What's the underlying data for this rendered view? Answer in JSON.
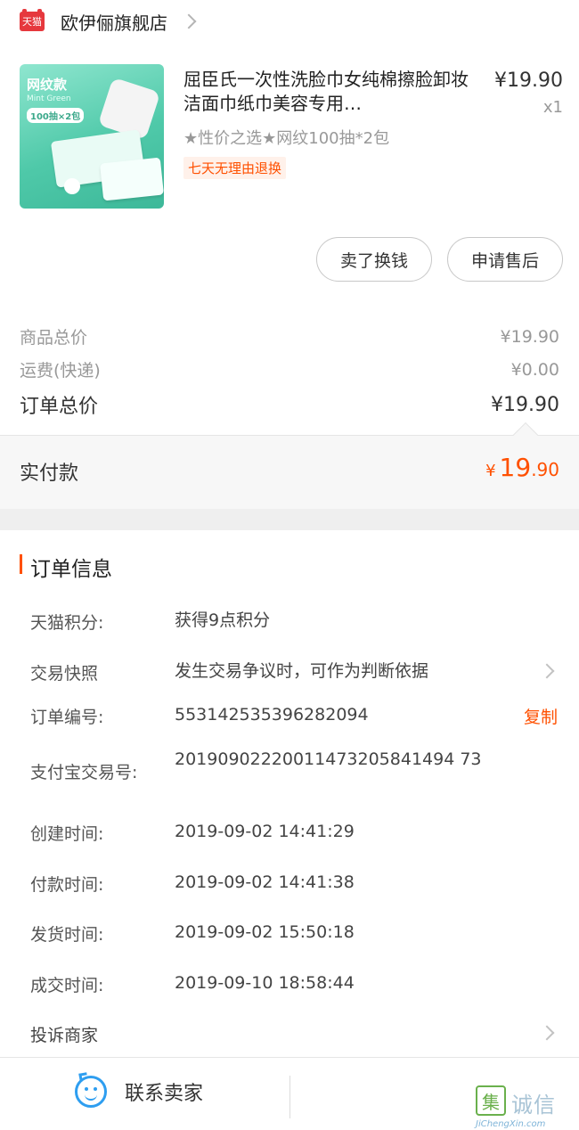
{
  "shop": {
    "badge": "天猫",
    "name": "欧伊俪旗舰店"
  },
  "product": {
    "thumb_tag": "网纹款",
    "thumb_sub": "Mint Green",
    "thumb_count": "100抽×2包",
    "title": "屈臣氏一次性洗脸巾女纯棉擦脸卸妆洁面巾纸巾美容专用…",
    "sku": "★性价之选★网纹100抽*2包",
    "return_badge": "七天无理由退换",
    "price": "¥19.90",
    "quantity": "x1"
  },
  "actions": {
    "sell": "卖了换钱",
    "aftersale": "申请售后"
  },
  "summary": {
    "goods_label": "商品总价",
    "goods_value": "¥19.90",
    "shipping_label": "运费(快递)",
    "shipping_value": "¥0.00",
    "total_label": "订单总价",
    "total_value": "¥19.90",
    "paid_label": "实付款",
    "paid_currency": "¥",
    "paid_int": "19",
    "paid_dec": ".90"
  },
  "order_info": {
    "title": "订单信息",
    "points_label": "天猫积分:",
    "points_value": "获得9点积分",
    "snapshot_label": "交易快照",
    "snapshot_value": "发生交易争议时，可作为判断依据",
    "order_no_label": "订单编号:",
    "order_no_value": "553142535396282094",
    "copy_label": "复制",
    "alipay_label": "支付宝交易号:",
    "alipay_value": "20190902220011473205841494 73",
    "created_label": "创建时间:",
    "created_value": "2019-09-02 14:41:29",
    "paid_label": "付款时间:",
    "paid_value": "2019-09-02 14:41:38",
    "shipped_label": "发货时间:",
    "shipped_value": "2019-09-02 15:50:18",
    "done_label": "成交时间:",
    "done_value": "2019-09-10 18:58:44",
    "complain_label": "投诉商家"
  },
  "bottom": {
    "contact_label": "联系卖家"
  },
  "watermark": {
    "mark": "集",
    "text": "诚信",
    "url": "JiChengXin.com"
  },
  "colors": {
    "accent": "#ff5000",
    "tmall_red": "#e6383d",
    "contact_blue": "#2e9ef0"
  }
}
